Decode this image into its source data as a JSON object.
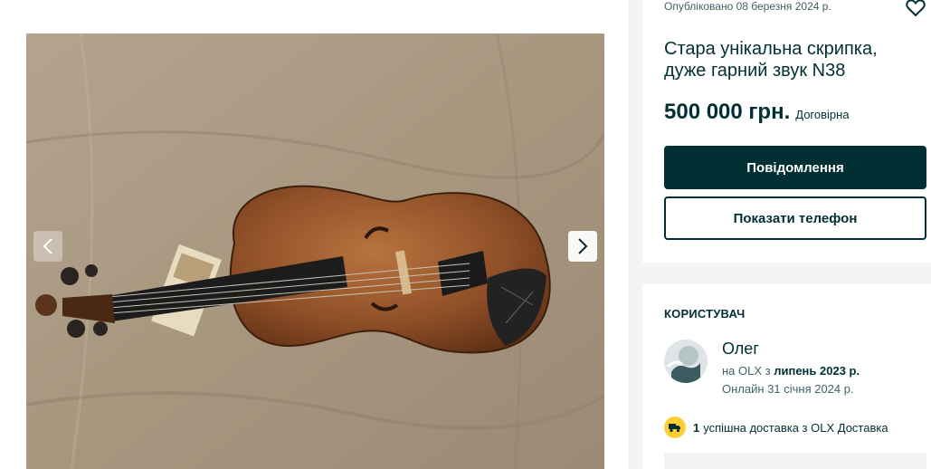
{
  "listing": {
    "posted": "Опубліковано 08 березня 2024 р.",
    "title": "Стара унікальна скрипка, дуже гарний звук N38",
    "price": "500 000 грн.",
    "negotiable": "Договірна",
    "message_button": "Повідомлення",
    "phone_button": "Показати телефон"
  },
  "gallery": {
    "image_subject": "violin",
    "prev_icon": "chevron-left-icon",
    "next_icon": "chevron-right-icon"
  },
  "user": {
    "heading": "КОРИСТУВАЧ",
    "name": "Олег",
    "since_prefix": "на OLX з ",
    "since_date": "липень 2023 р.",
    "online": "Онлайн 31 січня 2024 р."
  },
  "delivery": {
    "count": "1",
    "text": "успішна доставка з OLX Доставка"
  },
  "colors": {
    "brand_dark": "#002f34",
    "muted_text": "#406367",
    "delivery_badge": "#ffce32",
    "page_bg": "#f2f4f5"
  }
}
